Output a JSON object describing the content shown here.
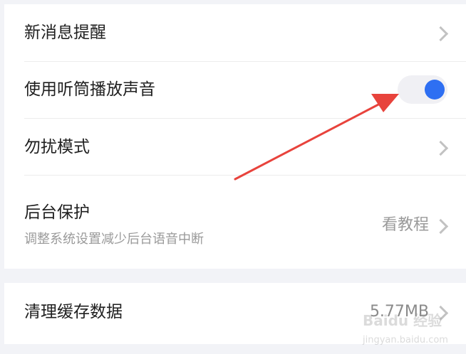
{
  "settings": {
    "items": [
      {
        "title": "新消息提醒"
      },
      {
        "title": "使用听筒播放声音",
        "toggle_on": true
      },
      {
        "title": "勿扰模式"
      },
      {
        "title": "后台保护",
        "subtitle": "调整系统设置减少后台语音中断",
        "action": "看教程"
      }
    ]
  },
  "storage": {
    "title": "清理缓存数据",
    "value": "5.77MB"
  },
  "watermark": {
    "text": "Baidu 经验",
    "url": "jingyan.baidu.com"
  },
  "colors": {
    "accent": "#2e6ff2",
    "annotation_arrow": "#e8433c",
    "background": "#f2f3f7"
  },
  "icons": {
    "chevron": "chevron-right-icon"
  }
}
